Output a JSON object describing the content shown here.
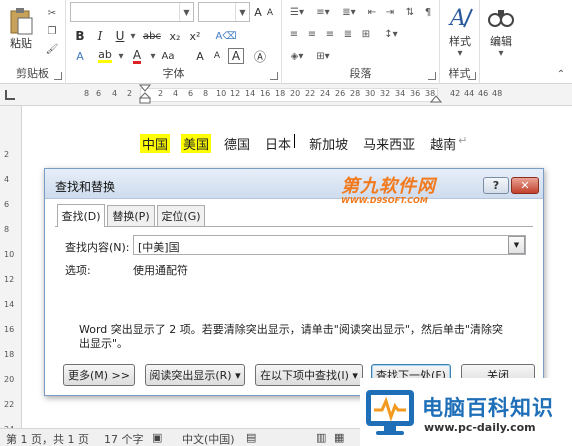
{
  "ribbon": {
    "clipboard": {
      "label": "剪贴板",
      "paste": "粘贴"
    },
    "font": {
      "label": "字体",
      "bold": "B",
      "italic": "I",
      "underline": "U",
      "strike": "abc",
      "subscript": "x₂",
      "superscript": "x²",
      "font_color": "A",
      "grow": "A",
      "shrink": "A",
      "case": "Aa"
    },
    "paragraph": {
      "label": "段落"
    },
    "styles": {
      "label": "样式",
      "button": "样式"
    },
    "editing": {
      "button": "编辑"
    }
  },
  "ruler": {
    "ticks": [
      "8",
      "6",
      "4",
      "2",
      "2",
      "4",
      "6",
      "8",
      "10",
      "12",
      "14",
      "16",
      "18",
      "20",
      "22",
      "24",
      "26",
      "28",
      "30",
      "32",
      "34",
      "36",
      "38",
      "42",
      "44",
      "46",
      "48"
    ]
  },
  "vruler": {
    "ticks": [
      "2",
      "4",
      "6",
      "8",
      "10",
      "12",
      "14",
      "16",
      "18",
      "20",
      "22",
      "24"
    ]
  },
  "document": {
    "words": [
      {
        "text": "中国",
        "highlight": true
      },
      {
        "text": "美国",
        "highlight": true
      },
      {
        "text": "德国",
        "highlight": false
      },
      {
        "text": "日本",
        "highlight": false
      },
      {
        "text": "新加坡",
        "highlight": false
      },
      {
        "text": "马来西亚",
        "highlight": false
      },
      {
        "text": "越南",
        "highlight": false
      }
    ],
    "para_mark": "↵"
  },
  "dialog": {
    "title": "查找和替换",
    "help": "?",
    "close": "✕",
    "watermark_title": "第九软件网",
    "watermark_url": "WWW.D9SOFT.COM",
    "tabs": [
      "查找(D)",
      "替换(P)",
      "定位(G)"
    ],
    "find_label": "查找内容(N):",
    "find_value": "[中美]国",
    "options_label": "选项:",
    "options_value": "使用通配符",
    "message": "Word 突出显示了 2 项。若要清除突出显示，请单击\"阅读突出显示\"，然后单击\"清除突出显示\"。",
    "buttons": {
      "more": "更多(M) >>",
      "reading_highlight": "阅读突出显示(R) ▾",
      "find_in": "在以下项中查找(I) ▾",
      "find_next": "查找下一处(F)",
      "close": "关闭"
    }
  },
  "statusbar": {
    "page": "第 1 页，共 1 页",
    "words": "17 个字",
    "language": "中文(中国)"
  },
  "logo": {
    "name": "电脑百科知识",
    "url": "www.pc-daily.com"
  },
  "colors": {
    "highlight": "#ffff00",
    "logo_blue": "#1e6fb8",
    "watermark_orange": "#f27a1e",
    "close_red": "#c2402c"
  }
}
